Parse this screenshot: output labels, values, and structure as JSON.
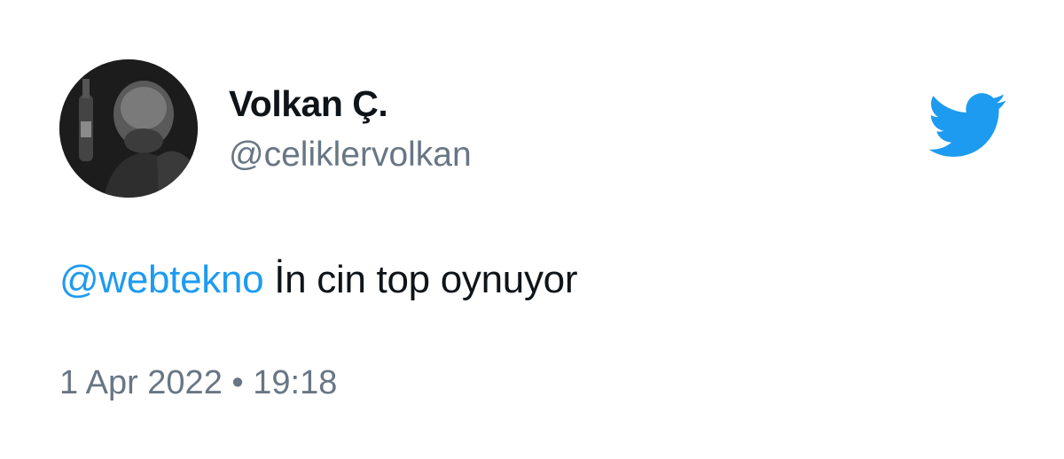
{
  "tweet": {
    "author": {
      "display_name": "Volkan Ç.",
      "handle": "@celiklervolkan"
    },
    "mention": "@webtekno",
    "body": " İn cin top oynuyor",
    "date": "1 Apr 2022",
    "separator": " • ",
    "time": "19:18"
  },
  "icons": {
    "brand": "twitter-bird-icon"
  },
  "colors": {
    "brand": "#1d9bf0",
    "text": "#0f1419",
    "secondary": "#687684"
  }
}
